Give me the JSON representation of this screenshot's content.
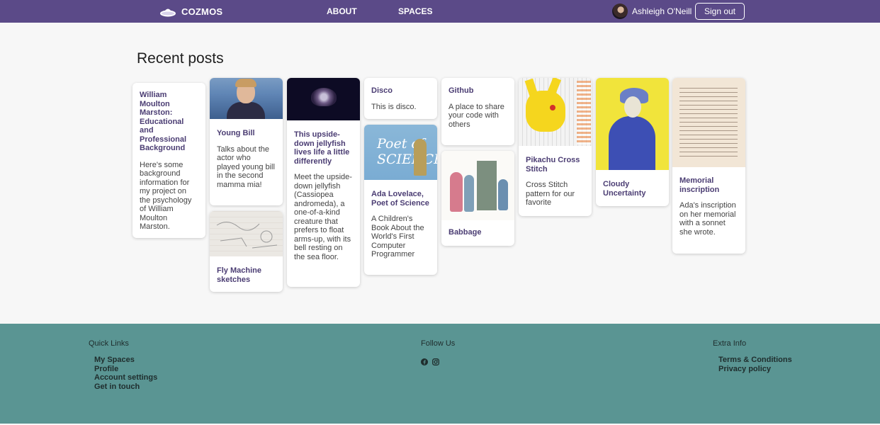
{
  "header": {
    "brand": "COZMOS",
    "nav": {
      "about": "ABOUT",
      "spaces": "SPACES"
    },
    "user_name": "Ashleigh O'Neill",
    "signout_label": "Sign out",
    "bg_color": "#5b4a88"
  },
  "main": {
    "title": "Recent posts",
    "cards": [
      {
        "title": "William Moulton Marston: Educational and Professional Background",
        "desc": "Here's some background information for my project on the psychology of William Moulton Marston."
      },
      {
        "title": "Young Bill",
        "desc": "Talks about the actor who played young bill in the second mamma mia!",
        "image_icon": "photo-young-bill"
      },
      {
        "title": "Fly Machine sketches",
        "desc": "",
        "image_icon": "photo-sketches"
      },
      {
        "title": "This upside-down jellyfish lives life a little differently",
        "desc": "Meet the upside-down jellyfish (Cassiopea andromeda), a one-of-a-kind creature that prefers to float arms-up, with its bell resting on the sea floor.",
        "image_icon": "photo-jellyfish"
      },
      {
        "title": "Disco",
        "desc": "This is disco."
      },
      {
        "title": "Ada Lovelace, Poet of Science",
        "desc": "A Children's Book About the World's First Computer Programmer",
        "image_icon": "book-cover-ada",
        "image_text": "Poet of SCIENCE"
      },
      {
        "title": "Github",
        "desc": "A place to share your code with others"
      },
      {
        "title": "Babbage",
        "desc": "",
        "image_icon": "illustration-babbage"
      },
      {
        "title": "Pikachu Cross Stitch",
        "desc": "Cross Stitch pattern for our favorite",
        "image_icon": "pikachu-pattern"
      },
      {
        "title": "Cloudy Uncertainty",
        "desc": "",
        "image_icon": "illustration-cloudy"
      },
      {
        "title": "Memorial inscription",
        "desc": "Ada's inscription on her memorial with a sonnet she wrote.",
        "image_icon": "photo-inscription"
      }
    ]
  },
  "footer": {
    "quick_links": {
      "heading": "Quick Links",
      "items": [
        "My Spaces",
        "Profile",
        "Account settings",
        "Get in touch"
      ]
    },
    "follow_us": {
      "heading": "Follow Us",
      "icons": [
        "facebook-icon",
        "instagram-icon"
      ]
    },
    "extra_info": {
      "heading": "Extra Info",
      "items": [
        "Terms & Conditions",
        "Privacy policy"
      ]
    },
    "bg_color": "#5a9593"
  }
}
